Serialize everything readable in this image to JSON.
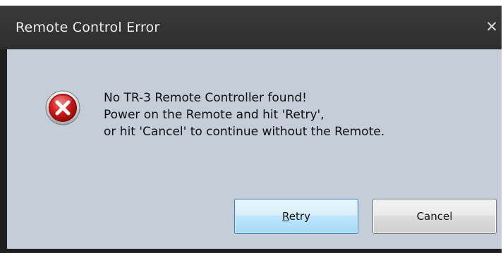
{
  "dialog": {
    "title": "Remote Control Error",
    "close_glyph": "✕",
    "icon": "error-icon",
    "message_lines": [
      "No TR-3 Remote Controller found!",
      "Power on the Remote and hit 'Retry',",
      "or hit 'Cancel' to continue without the Remote."
    ],
    "buttons": {
      "retry": {
        "mnemonic": "R",
        "rest": "etry"
      },
      "cancel": {
        "label": "Cancel"
      }
    }
  },
  "colors": {
    "titlebar": "#2e2e2e",
    "title_text": "#ececec",
    "client_background": "#c5cdd9",
    "error_red": "#c8102e",
    "default_button_border": "#3c7fb1"
  }
}
